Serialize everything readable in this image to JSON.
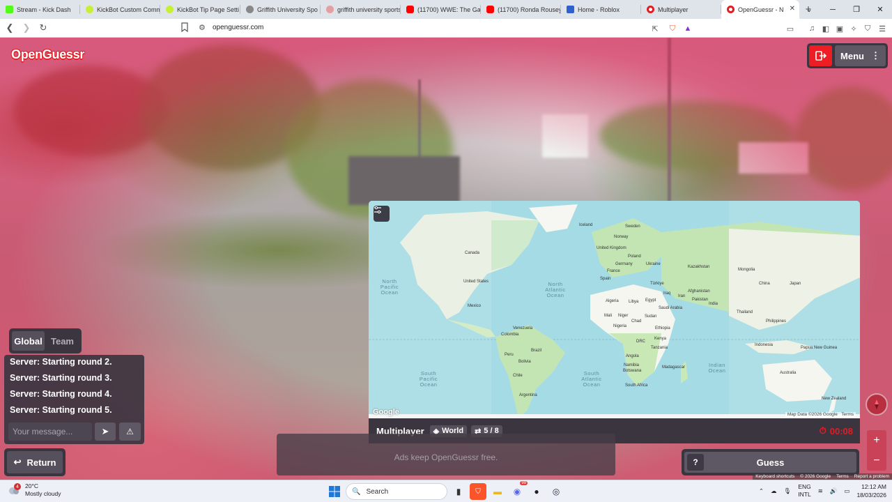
{
  "browser": {
    "tabs": [
      {
        "title": "Stream - Kick Dash",
        "color": "#53fc18"
      },
      {
        "title": "KickBot Custom Comm",
        "color": "#c7f034"
      },
      {
        "title": "KickBot Tip Page Setti",
        "color": "#c7f034"
      },
      {
        "title": "Griffith University Spo",
        "color": "#777777"
      },
      {
        "title": "griffith university sports",
        "color": "#d04040"
      },
      {
        "title": "(11700) WWE: The Ga",
        "color": "#ff0000"
      },
      {
        "title": "(11700) Ronda Rousey",
        "color": "#ff0000"
      },
      {
        "title": "Home - Roblox",
        "color": "#3060d0"
      },
      {
        "title": "Multiplayer",
        "color": "#e11d24"
      },
      {
        "title": "OpenGuessr - N",
        "color": "#e11d24"
      }
    ],
    "url": "openguessr.com"
  },
  "game": {
    "logo": "OpenGuessr",
    "menu_label": "Menu",
    "map": {
      "countries": [
        "Iceland",
        "Sweden",
        "Norway",
        "United Kingdom",
        "Poland",
        "Germany",
        "Ukraine",
        "France",
        "Kazakhstan",
        "Mongolia",
        "Spain",
        "Türkiye",
        "Algeria",
        "Libya",
        "Egypt",
        "Iraq",
        "Iran",
        "Afghanistan",
        "Pakistan",
        "China",
        "Japan",
        "Saudi Arabia",
        "India",
        "Thailand",
        "Mali",
        "Niger",
        "Chad",
        "Sudan",
        "Nigeria",
        "Ethiopia",
        "Venezuela",
        "Colombia",
        "Kenya",
        "Tanzania",
        "DRC",
        "Angola",
        "Brazil",
        "Peru",
        "Bolivia",
        "Namibia",
        "Botswana",
        "Madagascar",
        "South Africa",
        "Chile",
        "Argentina",
        "Indonesia",
        "Papua New Guinea",
        "Australia",
        "New Zealand",
        "Canada",
        "United States",
        "Mexico",
        "Philippines"
      ],
      "oceans": {
        "north_pacific": "North Pacific Ocean",
        "north_atlantic": "North Atlantic Ocean",
        "south_pacific": "South Pacific Ocean",
        "south_atlantic": "South Atlantic Ocean",
        "indian": "Indian Ocean"
      },
      "attribution": "Map Data ©2026 Google",
      "terms": "Terms",
      "google": "Google"
    },
    "status_bar": {
      "mode": "Multiplayer",
      "map_name": "World",
      "round": "5 / 8",
      "timer": "00:08"
    },
    "ad_text": "Ads keep OpenGuessr free.",
    "chat": {
      "tabs": [
        "Global",
        "Team"
      ],
      "messages": [
        "Server: Starting round 2.",
        "Server: Starting round 3.",
        "Server: Starting round 4.",
        "Server: Starting round 5."
      ],
      "placeholder": "Your message..."
    },
    "return_label": "Return",
    "guess_label": "Guess",
    "help_label": "?",
    "footer": [
      "Keyboard shortcuts",
      "© 2026 Google",
      "Terms",
      "Report a problem"
    ]
  },
  "taskbar": {
    "weather_temp": "20°C",
    "weather_desc": "Mostly cloudy",
    "weather_badge": "4",
    "search_label": "Search",
    "lang1": "ENG",
    "lang2": "INTL",
    "time": "12:12 AM",
    "date": "18/03/2026",
    "discord_badge": "99"
  }
}
